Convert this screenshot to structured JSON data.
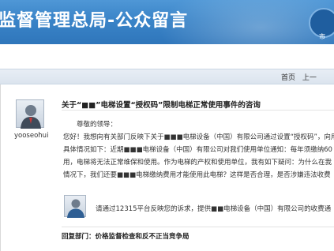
{
  "header": {
    "title": "监督管理总局-公众留言",
    "logo_text": "市"
  },
  "nav": {
    "home": "首页",
    "prev": "上一"
  },
  "user": {
    "name": "yooseohui"
  },
  "message": {
    "subject": "关于“■■”电梯设置“授权码”限制电梯正常使用事件的咨询",
    "greeting": "尊敬的领导：",
    "lines": [
      "您好！我想向有关部门反映下关于■■■电梯设备（中国）有限公司通过设置“授权码”，向用",
      "具体情况如下：近期■■■电梯设备（中国）有限公司对我们使用单位通知：每年须缴纳60",
      "用，电梯将无法正常维保和使用。作为电梯的产权和使用单位，我有如下疑问：为什么在我",
      "情况下，我们还要■■■电梯缴纳费用才能使用此电梯？这样是否合理，是否涉嫌违法收费"
    ]
  },
  "reply": {
    "text": "请通过12315平台反映您的诉求，提供■■电梯设备（中国）有限公司的收费通",
    "dept_label": "回复部门：",
    "dept_name": "价格监督检查和反不正当竞争局"
  }
}
